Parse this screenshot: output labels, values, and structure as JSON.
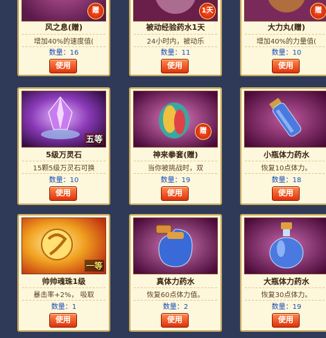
{
  "colors": {
    "background": "#2e3a57",
    "card": "#fdf7dc",
    "button": "#e0320c",
    "quantity": "#1a4fb5"
  },
  "items": [
    {
      "name": "风之息(赠)",
      "desc": "增加40%的速度值(",
      "qty_label": "数量：",
      "qty": "16",
      "button": "使用",
      "badge": "赠"
    },
    {
      "name": "被动经验药水1天",
      "desc": "24小时内，被动乐",
      "qty_label": "数量：",
      "qty": "11",
      "button": "使用",
      "badge": "1天"
    },
    {
      "name": "大力丸(赠)",
      "desc": "增加40%的力量值(",
      "qty_label": "数量：",
      "qty": "10",
      "button": "使用",
      "badge": "赠"
    },
    {
      "name": "5级万灵石",
      "desc": "15颗5级万灵石可换",
      "qty_label": "数量：",
      "qty": "10",
      "button": "使用",
      "badge": "五等"
    },
    {
      "name": "神来拳套(赠)",
      "desc": "当你被挑战时，双",
      "qty_label": "数量：",
      "qty": "19",
      "button": "使用",
      "badge": "赠"
    },
    {
      "name": "小瓶体力药水",
      "desc": "恢复10点体力。",
      "qty_label": "数量：",
      "qty": "18",
      "button": "使用",
      "badge": ""
    },
    {
      "name": "帅帅魂珠1级",
      "desc": "暴击率+2%， 吸取",
      "qty_label": "数量：",
      "qty": "1",
      "button": "使用",
      "badge": "一等"
    },
    {
      "name": "真体力药水",
      "desc": "恢复60点体力值。",
      "qty_label": "数量：",
      "qty": "2",
      "button": "使用",
      "badge": ""
    },
    {
      "name": "大瓶体力药水",
      "desc": "恢复30点体力。",
      "qty_label": "数量：",
      "qty": "19",
      "button": "使用",
      "badge": ""
    }
  ]
}
